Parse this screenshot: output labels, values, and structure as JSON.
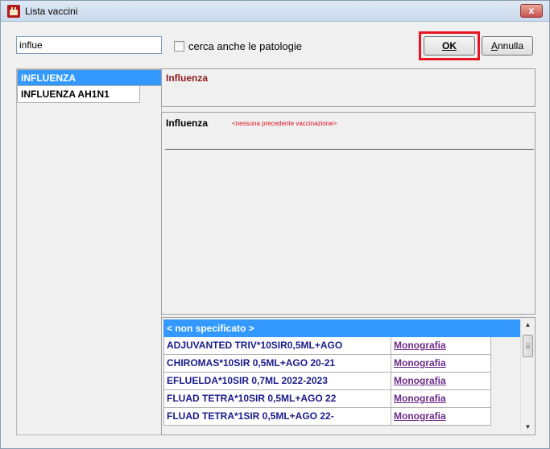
{
  "window": {
    "title": "Lista vaccini",
    "close_label": "x"
  },
  "search": {
    "value": "influe"
  },
  "options": {
    "also_pathologies_label": "cerca anche le patologie",
    "also_pathologies_checked": false
  },
  "buttons": {
    "ok_label": "OK",
    "annulla_first": "A",
    "annulla_rest": "nnulla"
  },
  "vaccine_list": {
    "items": [
      {
        "label": "INFLUENZA",
        "selected": true
      },
      {
        "label": "INFLUENZA AH1N1",
        "selected": false
      }
    ]
  },
  "detail": {
    "header_title": "Influenza",
    "vaccine_name": "Influenza",
    "note": "<nessuna precedente vaccinazione>"
  },
  "products": {
    "header": "< non specificato >",
    "rows": [
      {
        "name": "ADJUVANTED TRIV*10SIR0,5ML+AGO",
        "link": "Monografia"
      },
      {
        "name": "CHIROMAS*10SIR 0,5ML+AGO 20-21",
        "link": "Monografia"
      },
      {
        "name": "EFLUELDA*10SIR 0,7ML 2022-2023",
        "link": "Monografia"
      },
      {
        "name": "FLUAD TETRA*10SIR 0,5ML+AGO 22",
        "link": "Monografia"
      },
      {
        "name": "FLUAD TETRA*1SIR 0,5ML+AGO 22-",
        "link": "Monografia"
      }
    ]
  },
  "icons": {
    "app": "castle-icon",
    "close": "close-icon",
    "scroll_up": "arrow-up-icon",
    "scroll_down": "arrow-down-icon"
  },
  "colors": {
    "selection": "#3399ff",
    "highlight_border": "#e8141e",
    "note_red": "#e0121a",
    "title_maroon": "#8b1a1a",
    "link_purple": "#6b2a8a"
  }
}
